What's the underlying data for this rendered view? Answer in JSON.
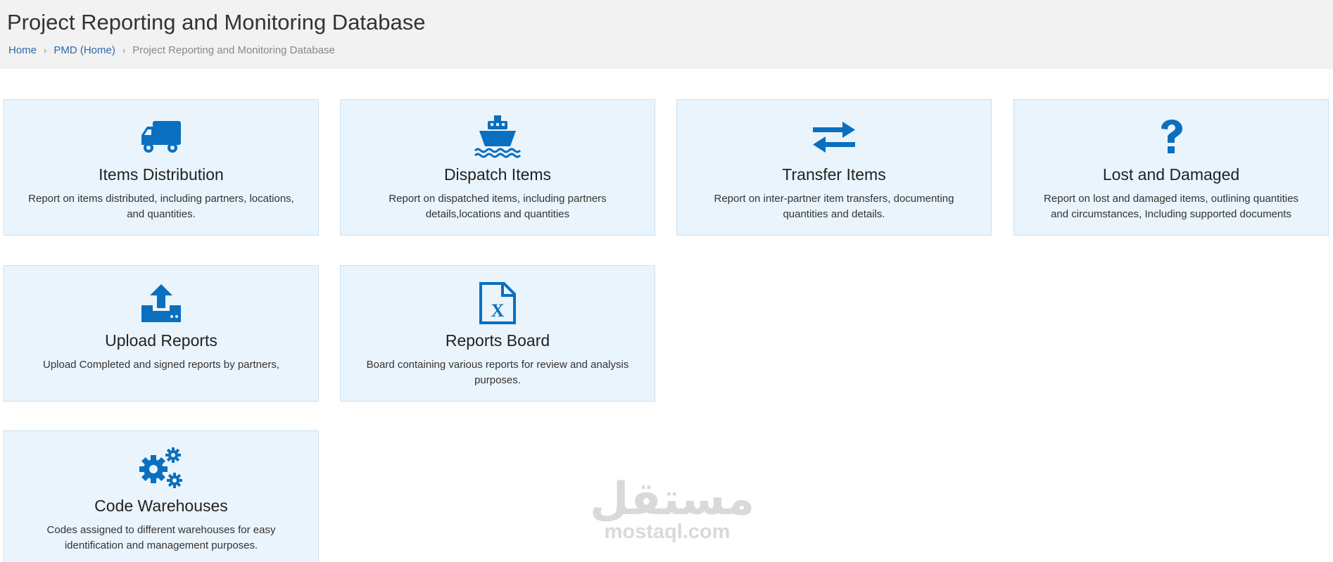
{
  "header": {
    "title": "Project Reporting and Monitoring Database",
    "breadcrumb": {
      "home": "Home",
      "pmd": "PMD (Home)",
      "current": "Project Reporting and Monitoring Database",
      "separator": "›"
    }
  },
  "colors": {
    "accent": "#0a6fbf",
    "card_bg": "#eaf4fc",
    "card_border": "#c9e2f4",
    "link": "#2b6aa7"
  },
  "cards": [
    {
      "icon": "truck-icon",
      "title": "Items Distribution",
      "desc": "Report on items distributed, including partners, locations, and quantities."
    },
    {
      "icon": "ship-icon",
      "title": "Dispatch Items",
      "desc": "Report on dispatched items, including partners details,locations and quantities"
    },
    {
      "icon": "exchange-icon",
      "title": "Transfer Items",
      "desc": "Report on inter-partner item transfers, documenting quantities and details."
    },
    {
      "icon": "question-icon",
      "title": "Lost and Damaged",
      "desc": "Report on lost and damaged items, outlining quantities and circumstances, Including supported documents"
    },
    {
      "icon": "upload-icon",
      "title": "Upload Reports",
      "desc": "Upload Completed and signed reports by partners,"
    },
    {
      "icon": "excel-file-icon",
      "title": "Reports Board",
      "desc": "Board containing various reports for review and analysis purposes."
    },
    {
      "icon": "gears-icon",
      "title": "Code Warehouses",
      "desc": "Codes assigned to different warehouses for easy identification and management purposes."
    }
  ],
  "watermark": {
    "arabic": "مستقل",
    "latin": "mostaql.com"
  }
}
